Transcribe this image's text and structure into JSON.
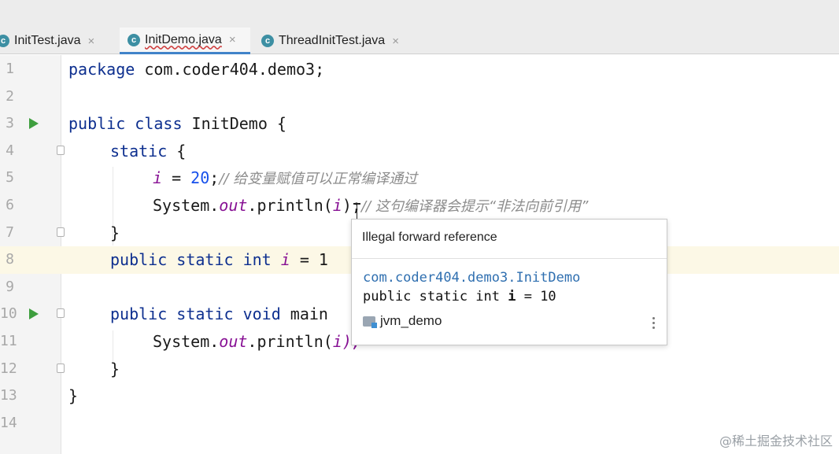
{
  "tabs": [
    {
      "label": "InitTest.java",
      "icon": "java-class-icon",
      "active": false
    },
    {
      "label": "InitDemo.java",
      "icon": "java-class-icon",
      "active": true
    },
    {
      "label": "ThreadInitTest.java",
      "icon": "java-class-icon",
      "active": false
    }
  ],
  "tab_close_glyph": "×",
  "tab_icon_letter": "c",
  "line_numbers": [
    "1",
    "2",
    "3",
    "4",
    "5",
    "6",
    "7",
    "8",
    "9",
    "10",
    "11",
    "12",
    "13",
    "14"
  ],
  "code": {
    "l1": {
      "kw": "package",
      "rest": " com.coder404.demo3;"
    },
    "l3": {
      "kw": "public class",
      "rest": " InitDemo {"
    },
    "l4": {
      "kw": "static",
      "rest": " {"
    },
    "l5": {
      "var": "i",
      "eq": " = ",
      "num": "20",
      "semi": ";",
      "comment": "// 给变量赋值可以正常编译通过"
    },
    "l6": {
      "a": "System.",
      "field": "out",
      "b": ".println(",
      "var": "i",
      "c": ");",
      "comment": "// 这句编译器会提示“非法向前引用”"
    },
    "l7": {
      "text": "}"
    },
    "l8": {
      "kw": "public static int",
      "sp": " ",
      "var": "i",
      "rest": " = 1"
    },
    "l10": {
      "kw": "public static void",
      "rest": " main"
    },
    "l11": {
      "a": "System.",
      "field": "out",
      "b": ".println(",
      "tail": "i);"
    },
    "l12": {
      "text": "}"
    },
    "l13": {
      "text": "}"
    }
  },
  "popup": {
    "message": "Illegal forward reference",
    "link": "com.coder404.demo3.InitDemo",
    "decl_prefix": "public static int ",
    "decl_name": "i",
    "decl_suffix": " = 10",
    "module": "jvm_demo"
  },
  "watermark": "@稀土掘金技术社区",
  "colors": {
    "keyword": "#0d2f8f",
    "number": "#1750eb",
    "static_field": "#871094",
    "comment": "#8c8c8c",
    "run_gutter": "#3e9e3e",
    "current_line": "#fcf8e6",
    "link": "#2f6fb0"
  }
}
